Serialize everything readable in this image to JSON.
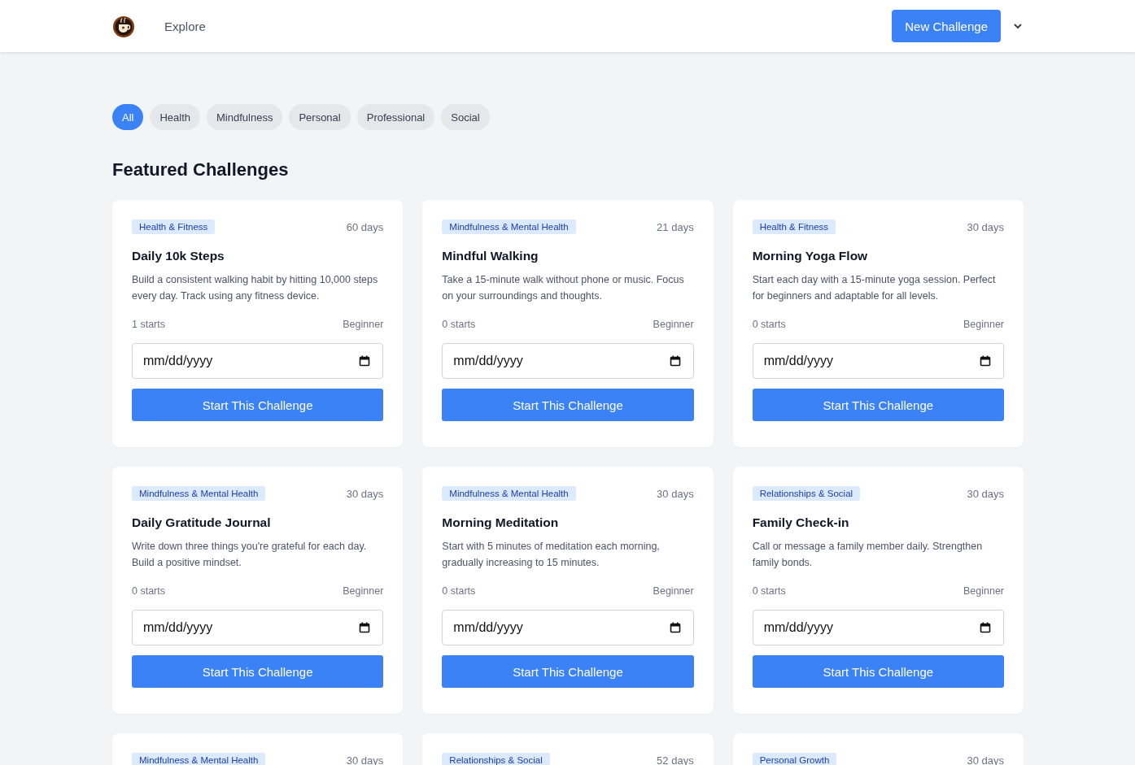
{
  "nav": {
    "links": [
      "Explore"
    ],
    "new_button": "New Challenge"
  },
  "filters": [
    {
      "label": "All",
      "selected": true
    },
    {
      "label": "Health",
      "selected": false
    },
    {
      "label": "Mindfulness",
      "selected": false
    },
    {
      "label": "Personal",
      "selected": false
    },
    {
      "label": "Professional",
      "selected": false
    },
    {
      "label": "Social",
      "selected": false
    }
  ],
  "heading": "Featured Challenges",
  "challenges": [
    {
      "category": "Health & Fitness",
      "duration": "60 days",
      "title": "Daily 10k Steps",
      "description": "Build a consistent walking habit by hitting 10,000 steps every day. Track using any fitness device.",
      "starts": "1 starts",
      "level": "Beginner",
      "date_placeholder": "mm/dd/yyyy",
      "button": "Start This Challenge"
    },
    {
      "category": "Mindfulness & Mental Health",
      "duration": "21 days",
      "title": "Mindful Walking",
      "description": "Take a 15-minute walk without phone or music. Focus on your surroundings and thoughts.",
      "starts": "0 starts",
      "level": "Beginner",
      "date_placeholder": "mm/dd/yyyy",
      "button": "Start This Challenge"
    },
    {
      "category": "Health & Fitness",
      "duration": "30 days",
      "title": "Morning Yoga Flow",
      "description": "Start each day with a 15-minute yoga session. Perfect for beginners and adaptable for all levels.",
      "starts": "0 starts",
      "level": "Beginner",
      "date_placeholder": "mm/dd/yyyy",
      "button": "Start This Challenge"
    },
    {
      "category": "Mindfulness & Mental Health",
      "duration": "30 days",
      "title": "Daily Gratitude Journal",
      "description": "Write down three things you're grateful for each day. Build a positive mindset.",
      "starts": "0 starts",
      "level": "Beginner",
      "date_placeholder": "mm/dd/yyyy",
      "button": "Start This Challenge"
    },
    {
      "category": "Mindfulness & Mental Health",
      "duration": "30 days",
      "title": "Morning Meditation",
      "description": "Start with 5 minutes of meditation each morning, gradually increasing to 15 minutes.",
      "starts": "0 starts",
      "level": "Beginner",
      "date_placeholder": "mm/dd/yyyy",
      "button": "Start This Challenge"
    },
    {
      "category": "Relationships & Social",
      "duration": "30 days",
      "title": "Family Check-in",
      "description": "Call or message a family member daily. Strengthen family bonds.",
      "starts": "0 starts",
      "level": "Beginner",
      "date_placeholder": "mm/dd/yyyy",
      "button": "Start This Challenge"
    },
    {
      "category": "Mindfulness & Mental Health",
      "duration": "30 days"
    },
    {
      "category": "Relationships & Social",
      "duration": "52 days"
    },
    {
      "category": "Personal Growth",
      "duration": "30 days"
    }
  ]
}
